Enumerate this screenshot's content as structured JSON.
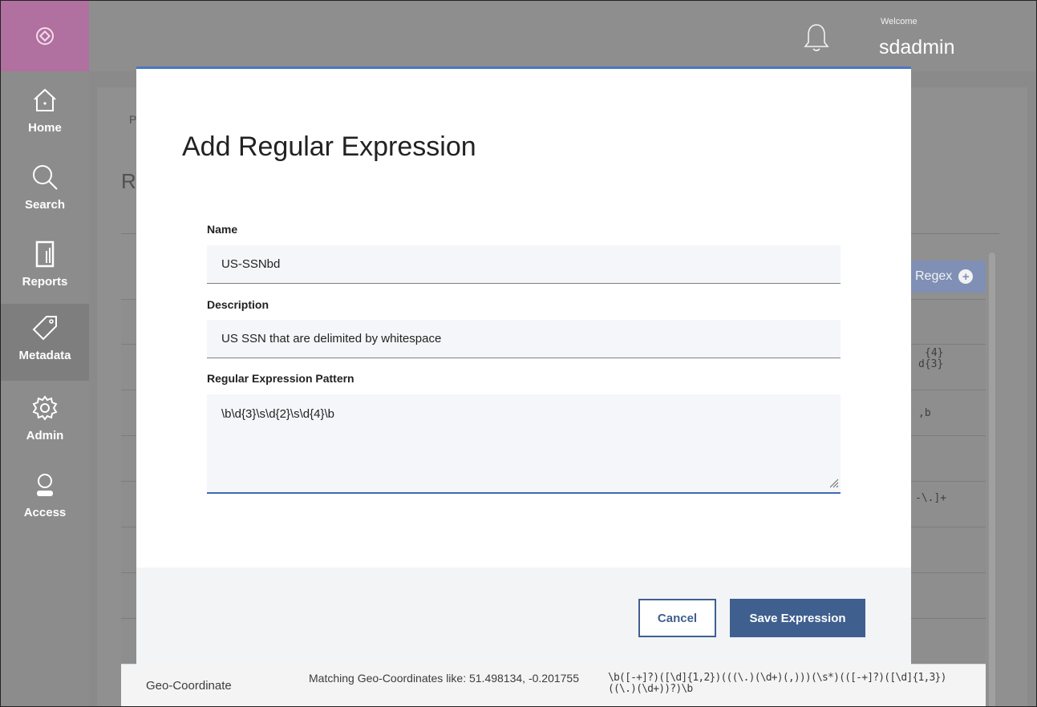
{
  "header": {
    "welcome_label": "Welcome",
    "username": "sdadmin",
    "icons": [
      "logo-icon",
      "bell-icon"
    ]
  },
  "sidebar": {
    "items": [
      {
        "label": "Home",
        "icon": "home-icon",
        "active": false
      },
      {
        "label": "Search",
        "icon": "search-icon",
        "active": false
      },
      {
        "label": "Reports",
        "icon": "reports-icon",
        "active": false
      },
      {
        "label": "Metadata",
        "icon": "tag-icon",
        "active": true
      },
      {
        "label": "Admin",
        "icon": "gear-icon",
        "active": false
      },
      {
        "label": "Access",
        "icon": "user-icon",
        "active": false
      }
    ]
  },
  "background": {
    "breadcrumb_fragment": "P",
    "title_fragment": "R",
    "add_regex_label": "Regex",
    "row_fragments": [
      "{4}",
      "d{3}",
      ",b",
      "-\\.]+"
    ],
    "visible_row": {
      "name": "Geo-Coordinate",
      "description": "Matching Geo-Coordinates like: 51.498134, -0.201755",
      "pattern": "\\b([-+]?)([\\d]{1,2})(((\\.)(\\d+)(,)))(\\s*)(([-+]?)([\\d]{1,3})((\\.)(\\d+))?)\\b"
    }
  },
  "modal": {
    "title": "Add Regular Expression",
    "name_label": "Name",
    "name_value": "US-SSNbd",
    "description_label": "Description",
    "description_value": "US SSN that are delimited by whitespace",
    "pattern_label": "Regular Expression Pattern",
    "pattern_value": "\\b\\d{3}\\s\\d{2}\\s\\d{4}\\b",
    "cancel_label": "Cancel",
    "save_label": "Save Expression"
  },
  "colors": {
    "primary_button": "#3f5f8f",
    "focus_border": "#4a77c2",
    "logo_tile": "#b070a0",
    "overlay_gray": "#8e8e8e"
  }
}
